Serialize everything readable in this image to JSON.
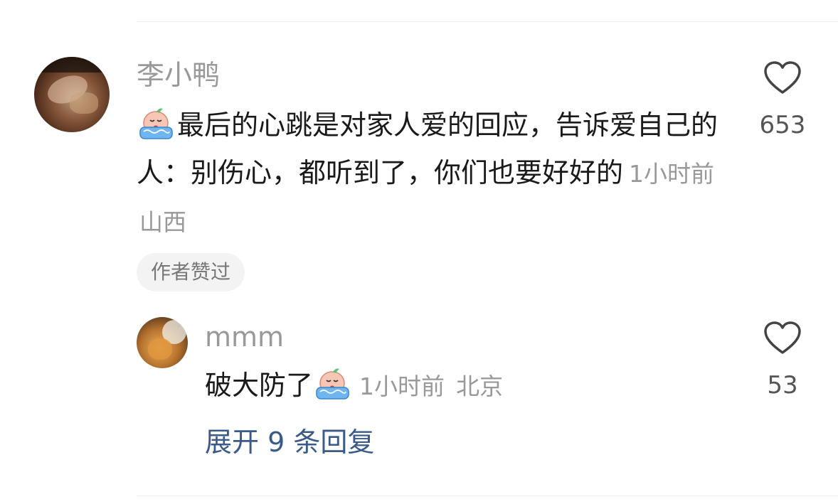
{
  "comment": {
    "username": "李小鸭",
    "emoji_icon": "crying-face-emoji-icon",
    "content": "最后的心跳是对家人爱的回应，告诉爱自己的人：别伤心，都听到了，你们也要好好的",
    "time": "1小时前",
    "location": "山西",
    "badge": "作者赞过",
    "like_count": "653"
  },
  "reply": {
    "username": "mmm",
    "content": "破大防了",
    "emoji_icon": "crying-face-emoji-icon",
    "time": "1小时前",
    "location": "北京",
    "like_count": "53"
  },
  "expand_replies": "展开 9 条回复"
}
